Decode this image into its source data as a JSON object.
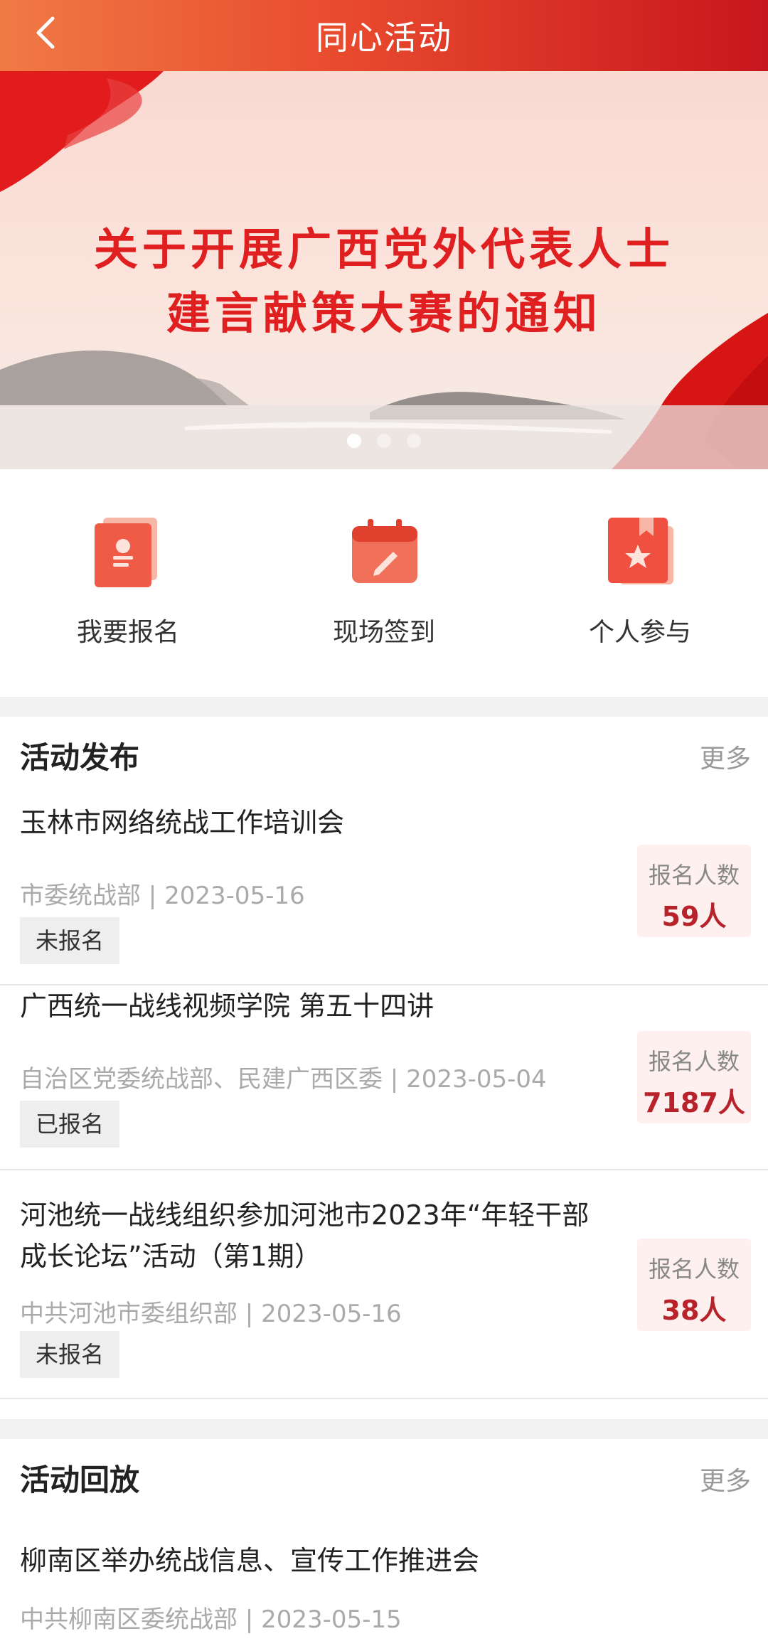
{
  "header": {
    "title": "同心活动"
  },
  "banner": {
    "title_line1": "关于开展广西党外代表人士",
    "title_line2": "建言献策大赛的通知",
    "slides": 3,
    "active_slide": 1
  },
  "quick_actions": [
    {
      "label": "我要报名",
      "icon": "registration-icon"
    },
    {
      "label": "现场签到",
      "icon": "calendar-checkin-icon"
    },
    {
      "label": "个人参与",
      "icon": "bookmark-star-icon"
    }
  ],
  "activity_publish": {
    "title": "活动发布",
    "more": "更多",
    "items": [
      {
        "title": "玉林市网络统战工作培训会",
        "meta": "市委统战部 | 2023-05-16",
        "status": "未报名",
        "count_label": "报名人数",
        "count": "59人"
      },
      {
        "title": "广西统一战线视频学院 第五十四讲",
        "meta": "自治区党委统战部、民建广西区委 | 2023-05-04",
        "status": "已报名",
        "count_label": "报名人数",
        "count": "7187人"
      },
      {
        "title": "河池统一战线组织参加河池市2023年“年轻干部成长论坛”活动（第1期）",
        "meta": "中共河池市委组织部 | 2023-05-16",
        "status": "未报名",
        "count_label": "报名人数",
        "count": "38人"
      }
    ]
  },
  "activity_replay": {
    "title": "活动回放",
    "more": "更多",
    "items": [
      {
        "title": "柳南区举办统战信息、宣传工作推进会",
        "meta": "中共柳南区委统战部 | 2023-05-15"
      }
    ]
  },
  "colors": {
    "accent": "#c8161d",
    "header_start": "#f07a45",
    "count_text": "#b8232b"
  }
}
